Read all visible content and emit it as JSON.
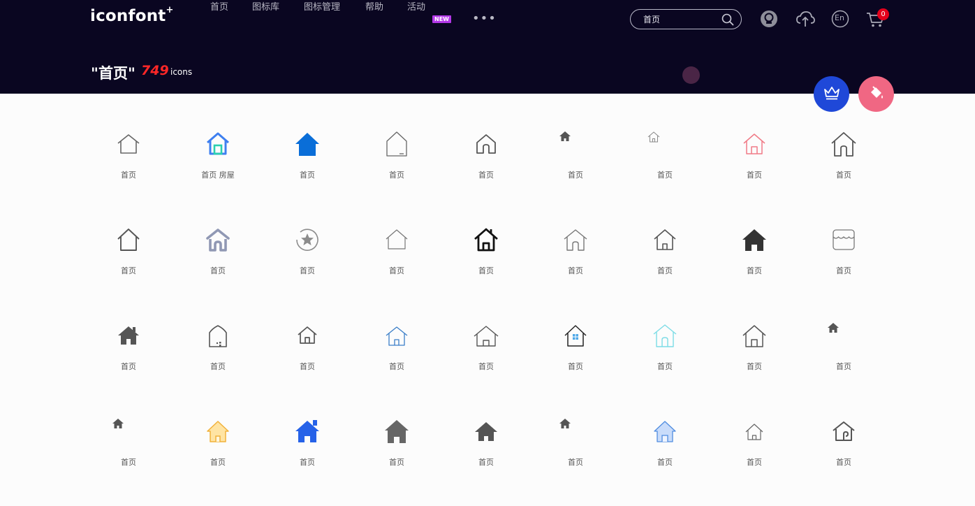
{
  "header": {
    "logo": "iconfont",
    "logo_mark": "+",
    "nav": [
      {
        "label": "首页"
      },
      {
        "label": "图标库"
      },
      {
        "label": "图标管理"
      },
      {
        "label": "帮助"
      },
      {
        "label": "活动",
        "badge": "NEW"
      }
    ],
    "more_icon": "more-dots-icon",
    "search": {
      "value": "首页",
      "icon": "search-icon"
    },
    "icons": [
      "github-icon",
      "upload-icon",
      "language-en-icon",
      "cart-icon"
    ],
    "language_label": "En",
    "cart_count": "0"
  },
  "results": {
    "query_display": "\"首页\"",
    "count": "749",
    "unit": "icons"
  },
  "fabs": {
    "crown": "crown-icon",
    "paint": "paint-bucket-icon"
  },
  "colors": {
    "header_bg": "#0a0621",
    "accent_red": "#ff2727",
    "badge_purple": "#b338e8",
    "fab_blue": "#1f48d8",
    "fab_pink": "#f06783"
  },
  "icons": [
    {
      "label": "首页",
      "icon": "home-outline-icon"
    },
    {
      "label": "首页 房屋",
      "icon": "home-blue-door-icon"
    },
    {
      "label": "首页",
      "icon": "home-filled-blue-icon"
    },
    {
      "label": "首页",
      "icon": "home-tall-outline-icon"
    },
    {
      "label": "首页",
      "icon": "home-rounded-outline-icon"
    },
    {
      "label": "首页",
      "icon": "home-small-filled-icon"
    },
    {
      "label": "首页",
      "icon": "home-small-outline-icon"
    },
    {
      "label": "首页",
      "icon": "home-pink-outline-icon"
    },
    {
      "label": "首页",
      "icon": "home-large-outline-icon"
    },
    {
      "label": "首页",
      "icon": "home-outline-icon"
    },
    {
      "label": "首页",
      "icon": "home-arch-gray-icon"
    },
    {
      "label": "首页",
      "icon": "home-star-circle-icon"
    },
    {
      "label": "首页",
      "icon": "home-thin-outline-icon"
    },
    {
      "label": "首页",
      "icon": "home-bold-outline-icon"
    },
    {
      "label": "首页",
      "icon": "home-arch-outline-icon"
    },
    {
      "label": "首页",
      "icon": "home-door-outline-icon"
    },
    {
      "label": "首页",
      "icon": "home-filled-dark-icon"
    },
    {
      "label": "首页",
      "icon": "home-shop-outline-icon"
    },
    {
      "label": "首页",
      "icon": "home-filled-chimney-icon"
    },
    {
      "label": "首页",
      "icon": "home-arched-outline-icon"
    },
    {
      "label": "首页",
      "icon": "home-door-small-icon"
    },
    {
      "label": "首页",
      "icon": "home-blue-outline-icon"
    },
    {
      "label": "首页",
      "icon": "home-wide-outline-icon"
    },
    {
      "label": "首页",
      "icon": "home-window-icon"
    },
    {
      "label": "首页",
      "icon": "home-cyan-outline-icon"
    },
    {
      "label": "首页",
      "icon": "home-door-outline-icon"
    },
    {
      "label": "首页",
      "icon": "home-small-filled-icon"
    },
    {
      "label": "首页",
      "icon": "home-small-filled-icon"
    },
    {
      "label": "首页",
      "icon": "home-yellow-icon"
    },
    {
      "label": "首页",
      "icon": "home-filled-blue-chimney-icon"
    },
    {
      "label": "首页",
      "icon": "home-filled-gray-icon"
    },
    {
      "label": "首页",
      "icon": "home-filled-gray-roof-icon"
    },
    {
      "label": "首页",
      "icon": "home-small-filled-icon"
    },
    {
      "label": "首页",
      "icon": "home-lightblue-icon"
    },
    {
      "label": "首页",
      "icon": "home-tiny-outline-icon"
    },
    {
      "label": "首页",
      "icon": "home-swirl-outline-icon"
    }
  ]
}
